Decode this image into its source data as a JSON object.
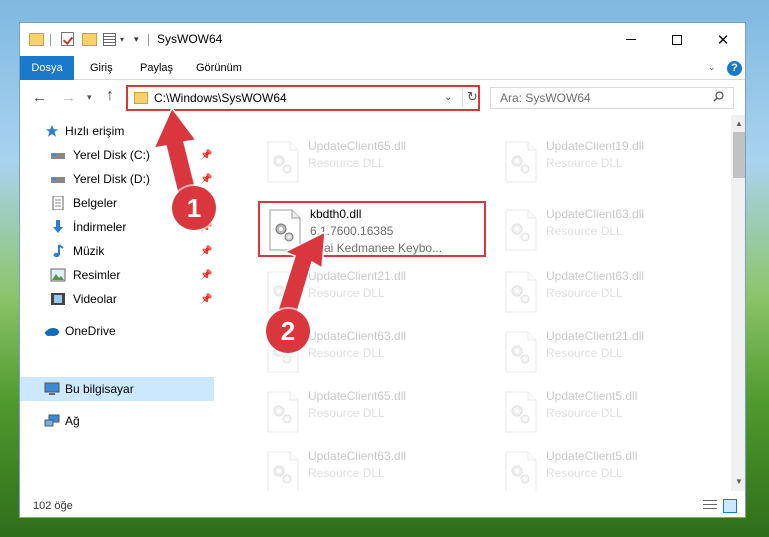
{
  "window": {
    "title": "SysWOW64",
    "controls": {
      "minimize": "",
      "maximize": "",
      "close": "✕"
    }
  },
  "ribbon": {
    "tabs": [
      "Dosya",
      "Giriş",
      "Paylaş",
      "Görünüm"
    ],
    "help": "?"
  },
  "address": {
    "path": "C:\\Windows\\SysWOW64",
    "search_placeholder": "Ara: SysWOW64"
  },
  "sidebar": {
    "items": [
      {
        "label": "Hızlı erişim",
        "icon": "star-icon"
      },
      {
        "label": "Yerel Disk (C:)",
        "icon": "drive-icon",
        "pinned": true
      },
      {
        "label": "Yerel Disk (D:)",
        "icon": "drive-icon",
        "pinned": true
      },
      {
        "label": "Belgeler",
        "icon": "documents-icon",
        "pinned": true
      },
      {
        "label": "İndirmeler",
        "icon": "downloads-icon",
        "pinned": true
      },
      {
        "label": "Müzik",
        "icon": "music-icon",
        "pinned": true
      },
      {
        "label": "Resimler",
        "icon": "pictures-icon",
        "pinned": true
      },
      {
        "label": "Videolar",
        "icon": "videos-icon",
        "pinned": true
      },
      {
        "label": "OneDrive",
        "icon": "cloud-icon"
      },
      {
        "label": "Bu bilgisayar",
        "icon": "computer-icon",
        "selected": true
      },
      {
        "label": "Ağ",
        "icon": "network-icon"
      }
    ]
  },
  "files": {
    "col1": [
      {
        "name": "UpdateClient65.dll",
        "sub1": "Resource DLL",
        "sub2": ""
      },
      {
        "name": "kbdth0.dll",
        "sub1": "6.1.7600.16385",
        "sub2": "Thai Kedmanee Keybo...",
        "highlight": true
      },
      {
        "name": "UpdateClient21.dll",
        "sub1": "Resource DLL",
        "sub2": ""
      },
      {
        "name": "UpdateClient63.dll",
        "sub1": "Resource DLL",
        "sub2": ""
      },
      {
        "name": "UpdateClient65.dll",
        "sub1": "Resource DLL",
        "sub2": ""
      },
      {
        "name": "UpdateClient63.dll",
        "sub1": "Resource DLL",
        "sub2": ""
      }
    ],
    "col2": [
      {
        "name": "UpdateClient19.dll",
        "sub1": "Resource DLL"
      },
      {
        "name": "UpdateClient63.dll",
        "sub1": "Resource DLL"
      },
      {
        "name": "UpdateClient63.dll",
        "sub1": "Resource DLL"
      },
      {
        "name": "UpdateClient21.dll",
        "sub1": "Resource DLL"
      },
      {
        "name": "UpdateClient5.dll",
        "sub1": "Resource DLL"
      },
      {
        "name": "UpdateClient5.dll",
        "sub1": "Resource DLL"
      }
    ]
  },
  "status": {
    "count": "102 öğe"
  },
  "annotations": {
    "step1": "1",
    "step2": "2"
  },
  "colors": {
    "accent": "#1979ca",
    "highlight": "#d9363e",
    "selected": "#cce8ff"
  }
}
